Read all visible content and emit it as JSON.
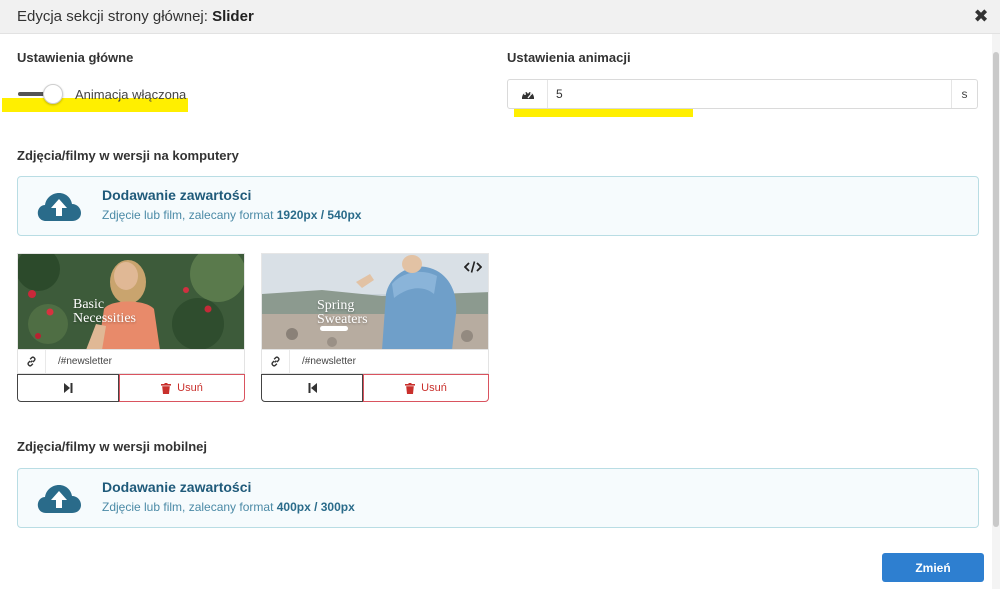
{
  "dialog": {
    "title_prefix": "Edycja sekcji strony głównej: ",
    "title_bold": "Slider",
    "close_glyph": "✖"
  },
  "main_settings": {
    "label": "Ustawienia główne",
    "toggle_label": "Animacja włączona",
    "toggle_on": true
  },
  "animation_settings": {
    "label": "Ustawienia animacji",
    "icon": "speedometer-icon",
    "value": "5",
    "unit": "s"
  },
  "desktop": {
    "label": "Zdjęcia/filmy w wersji na komputery",
    "upload_title": "Dodawanie zawartości",
    "upload_sub_prefix": "Zdjęcie lub film, zalecany format ",
    "upload_sub_format": "1920px / 540px",
    "items": [
      {
        "caption_line1": "Basic",
        "caption_line2": "Necessities",
        "link": "/#newsletter",
        "move_icon": "skip-next-icon",
        "delete_label": "Usuń",
        "has_code_badge": false
      },
      {
        "caption_line1": "Spring",
        "caption_line2": "Sweaters",
        "link": "/#newsletter",
        "move_icon": "skip-previous-icon",
        "delete_label": "Usuń",
        "has_code_badge": true
      }
    ]
  },
  "mobile": {
    "label": "Zdjęcia/filmy w wersji mobilnej",
    "upload_title": "Dodawanie zawartości",
    "upload_sub_prefix": "Zdjęcie lub film, zalecany format ",
    "upload_sub_format": "400px / 300px"
  },
  "footer": {
    "submit_label": "Zmień"
  },
  "colors": {
    "highlight": "#ffef00",
    "primary_button": "#2e7fd0",
    "danger": "#c9302c",
    "upload_accent": "#2a6b8a"
  }
}
